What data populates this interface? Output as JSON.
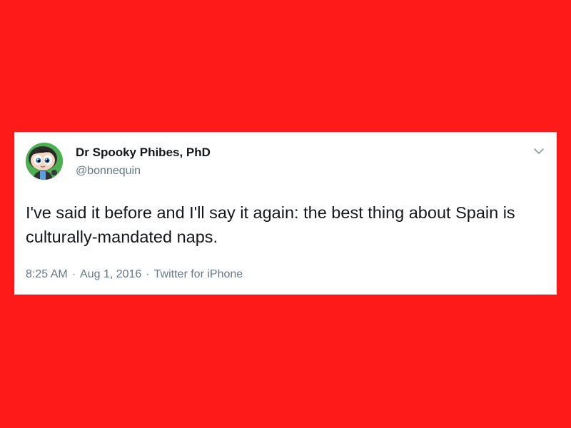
{
  "tweet": {
    "display_name": "Dr Spooky Phibes, PhD",
    "handle": "@bonnequin",
    "text": "I've said it before and I'll say it again: the best thing about Spain is culturally-mandated naps.",
    "time": "8:25 AM",
    "separator": "·",
    "date": "Aug 1, 2016",
    "source": "Twitter for iPhone"
  },
  "icons": {
    "menu": "chevron-down-icon",
    "avatar": "avatar-cartoon-character"
  },
  "colors": {
    "background": "#ff1a1a",
    "card": "#ffffff",
    "text": "#14171a",
    "muted": "#657786",
    "avatar_bg": "#4caf50"
  }
}
